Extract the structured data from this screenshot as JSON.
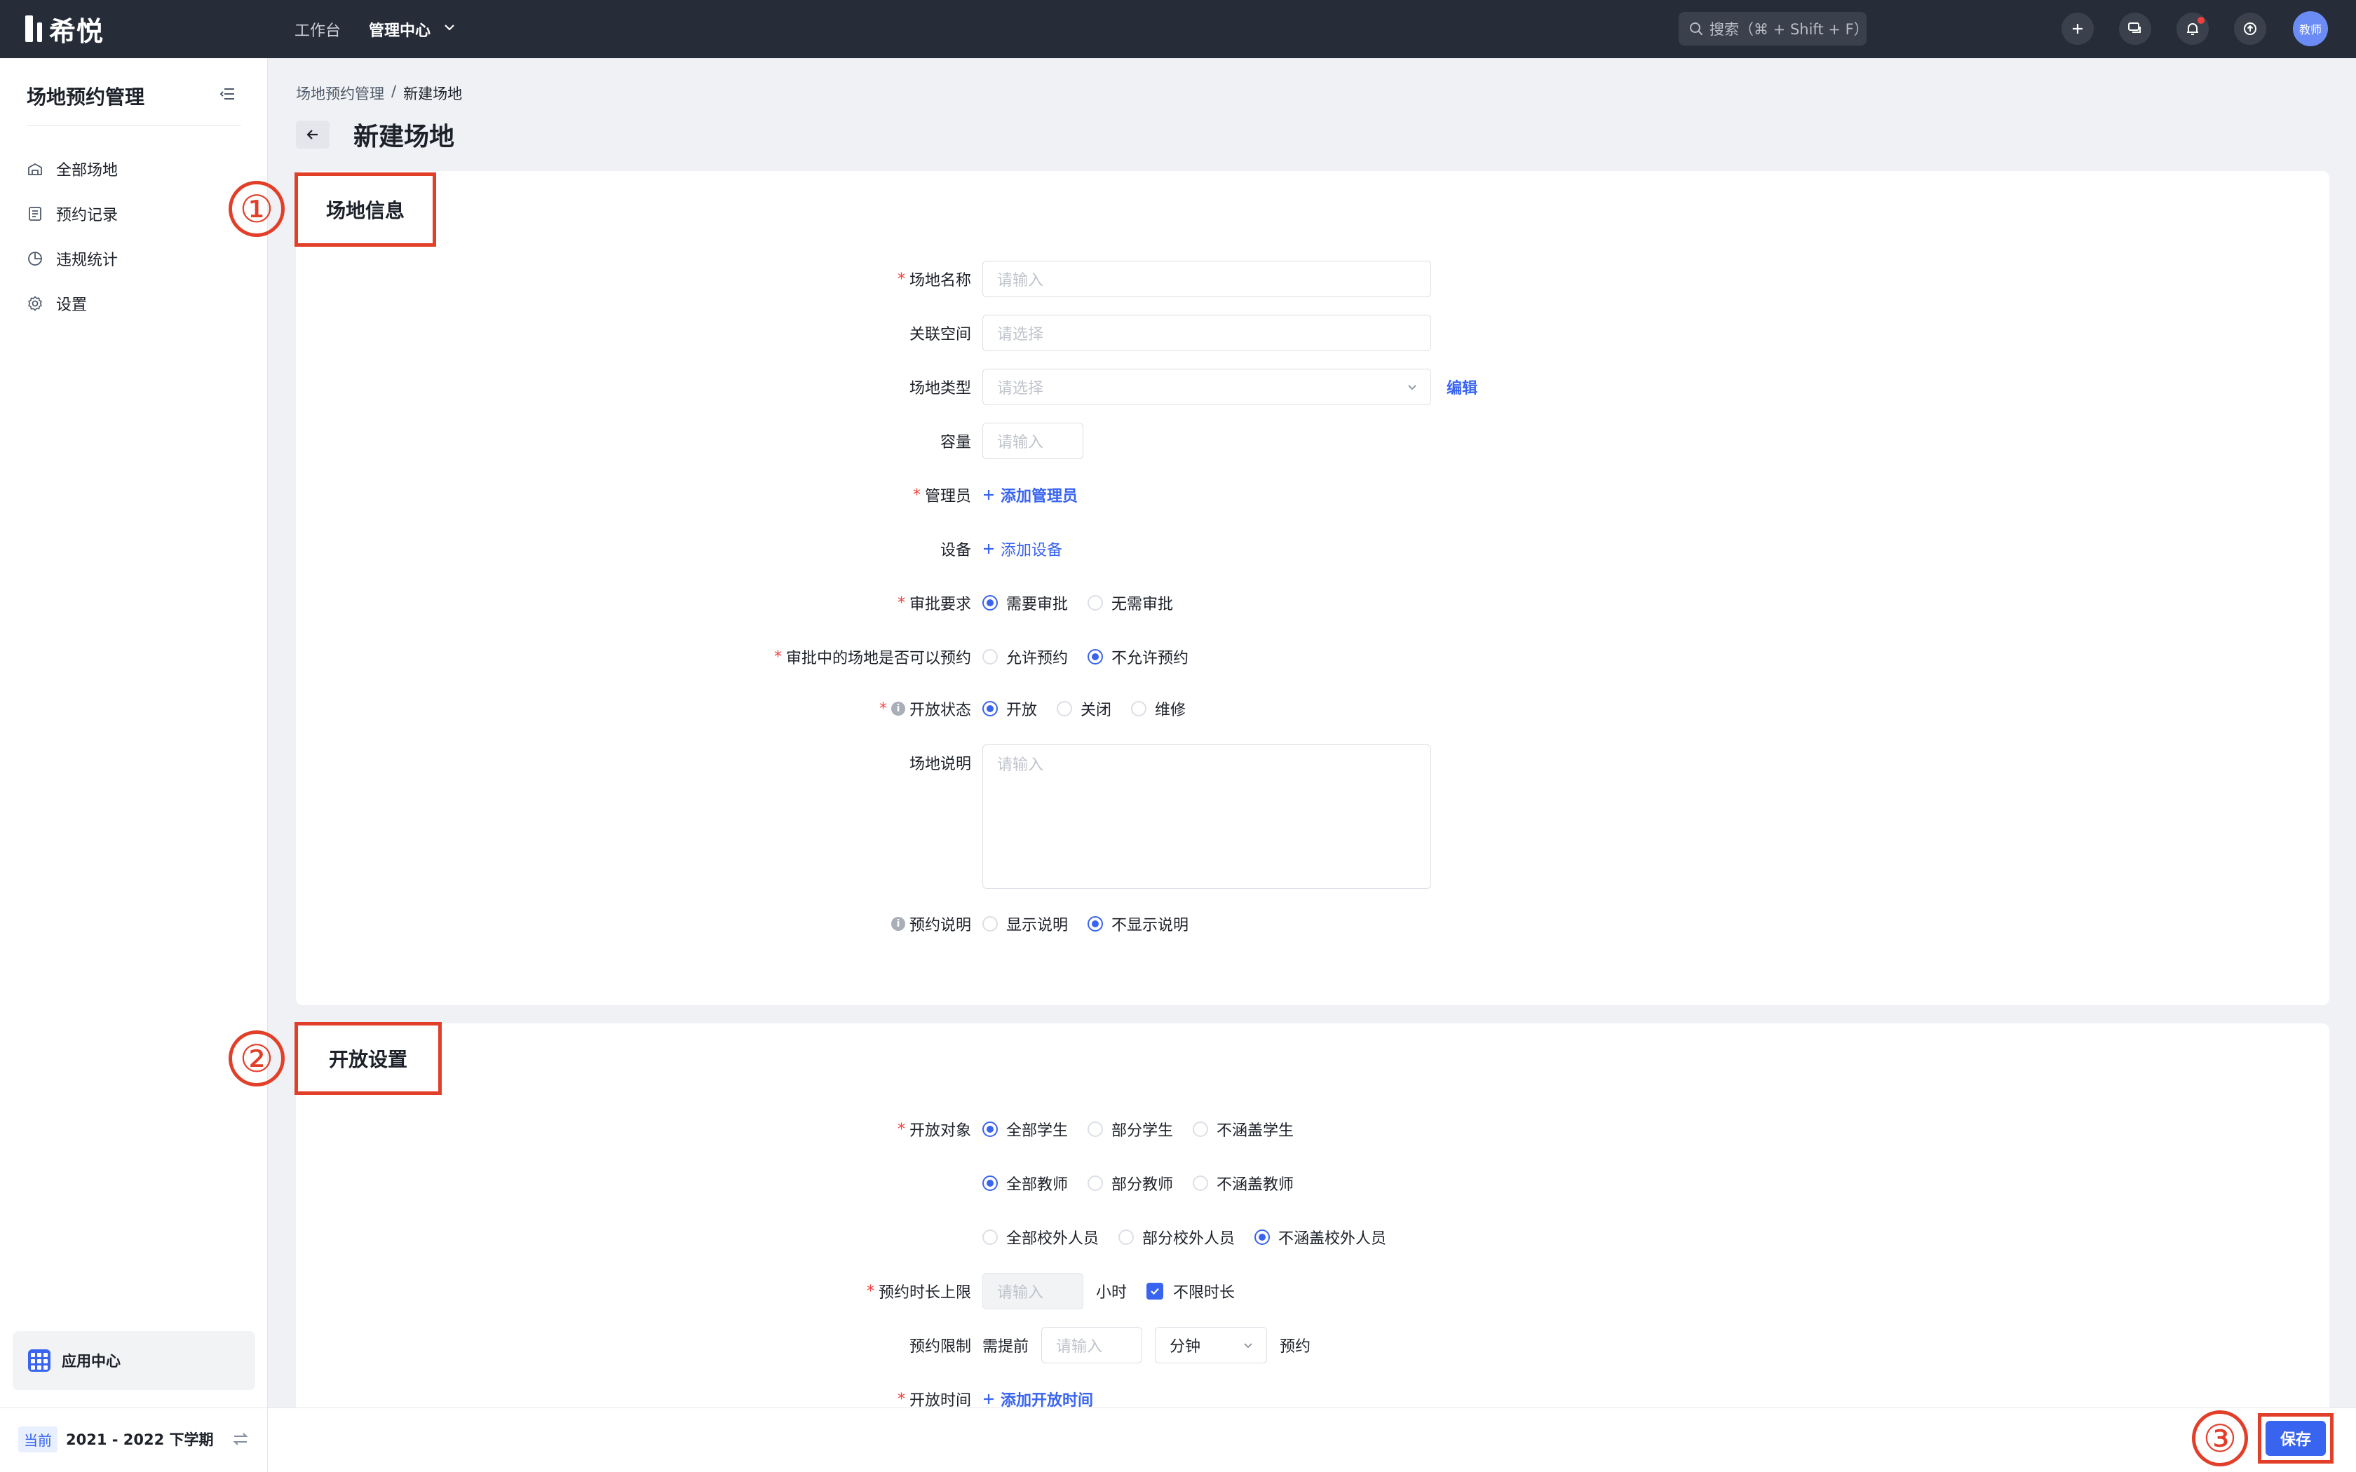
{
  "topbar": {
    "logo": "希悦",
    "nav": [
      "工作台",
      "管理中心"
    ],
    "search_placeholder": "搜索（⌘ + Shift + F）",
    "avatar": "教师"
  },
  "sidebar": {
    "title": "场地预约管理",
    "items": [
      {
        "label": "全部场地",
        "icon": "venue-icon"
      },
      {
        "label": "预约记录",
        "icon": "record-icon"
      },
      {
        "label": "违规统计",
        "icon": "pie-chart-icon"
      },
      {
        "label": "设置",
        "icon": "gear-icon"
      }
    ],
    "app_center": "应用中心",
    "term_badge": "当前",
    "term": "2021 - 2022 下学期"
  },
  "breadcrumb": {
    "parent": "场地预约管理",
    "sep": "/",
    "current": "新建场地"
  },
  "page_title": "新建场地",
  "section1": {
    "title": "场地信息",
    "marker": "①",
    "fields": {
      "name": {
        "label": "场地名称",
        "placeholder": "请输入"
      },
      "space": {
        "label": "关联空间",
        "placeholder": "请选择"
      },
      "type": {
        "label": "场地类型",
        "placeholder": "请选择",
        "edit": "编辑"
      },
      "capacity": {
        "label": "容量",
        "placeholder": "请输入"
      },
      "admin": {
        "label": "管理员",
        "add": "添加管理员"
      },
      "device": {
        "label": "设备",
        "add": "添加设备"
      },
      "approval": {
        "label": "审批要求",
        "options": [
          "需要审批",
          "无需审批"
        ],
        "selected": 0
      },
      "in_approval": {
        "label": "审批中的场地是否可以预约",
        "options": [
          "允许预约",
          "不允许预约"
        ],
        "selected": 1
      },
      "status": {
        "label": "开放状态",
        "options": [
          "开放",
          "关闭",
          "维修"
        ],
        "selected": 0
      },
      "desc": {
        "label": "场地说明",
        "placeholder": "请输入"
      },
      "booking_desc": {
        "label": "预约说明",
        "options": [
          "显示说明",
          "不显示说明"
        ],
        "selected": 1
      }
    }
  },
  "section2": {
    "title": "开放设置",
    "marker": "②",
    "fields": {
      "target": {
        "label": "开放对象",
        "students": [
          "全部学生",
          "部分学生",
          "不涵盖学生"
        ],
        "teachers": [
          "全部教师",
          "部分教师",
          "不涵盖教师"
        ],
        "outsiders": [
          "全部校外人员",
          "部分校外人员",
          "不涵盖校外人员"
        ]
      },
      "duration": {
        "label": "预约时长上限",
        "placeholder": "请输入",
        "unit": "小时",
        "unlimited": "不限时长"
      },
      "limit": {
        "label": "预约限制",
        "prefix": "需提前",
        "placeholder": "请输入",
        "unit": "分钟",
        "suffix": "预约"
      },
      "open_time": {
        "label": "开放时间",
        "add": "添加开放时间"
      }
    }
  },
  "footer": {
    "save": "保存",
    "marker": "③"
  }
}
